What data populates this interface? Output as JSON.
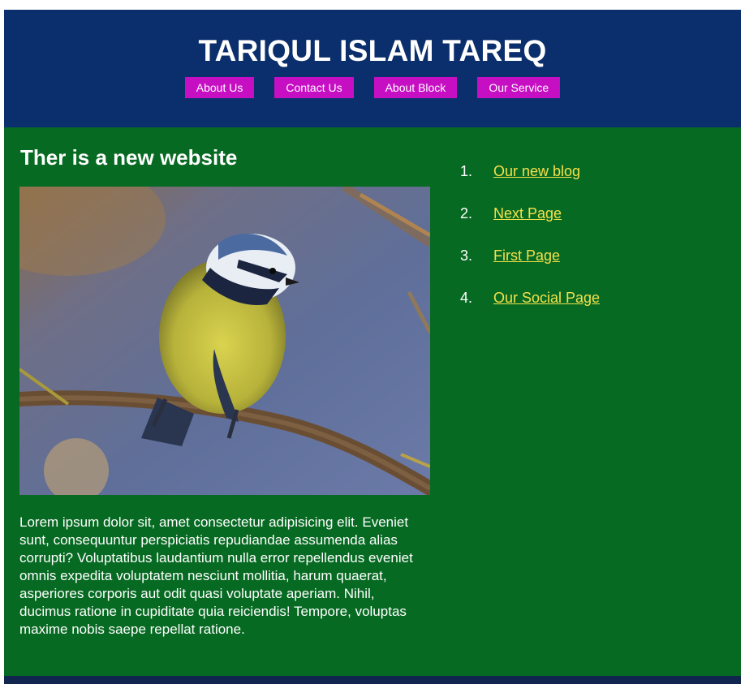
{
  "header": {
    "title": "TARIQUL ISLAM TAREQ",
    "nav": [
      {
        "label": "About Us"
      },
      {
        "label": "Contact Us"
      },
      {
        "label": "About Block"
      },
      {
        "label": "Our Service"
      }
    ]
  },
  "article": {
    "title": "Ther is a new website",
    "body": "Lorem ipsum dolor sit, amet consectetur adipisicing elit. Eveniet sunt, consequuntur perspiciatis repudiandae assumenda alias corrupti? Voluptatibus laudantium nulla error repellendus eveniet omnis expedita voluptatem nesciunt mollitia, harum quaerat, asperiores corporis aut odit quasi voluptate aperiam. Nihil, ducimus ratione in cupiditate quia reiciendis! Tempore, voluptas maxime nobis saepe repellat ratione."
  },
  "sidebar": {
    "links": [
      {
        "num": "1.",
        "label": "Our new blog"
      },
      {
        "num": "2.",
        "label": "Next Page"
      },
      {
        "num": "3.",
        "label": "First Page"
      },
      {
        "num": "4.",
        "label": "Our Social Page"
      }
    ]
  },
  "colors": {
    "header_bg": "#0b2f6c",
    "nav_button_bg": "#c60fc3",
    "main_bg": "#076a22",
    "link_color": "#f4e04b"
  }
}
